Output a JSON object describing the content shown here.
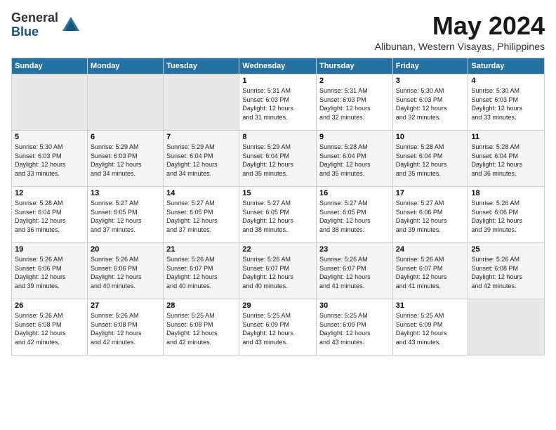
{
  "logo": {
    "general": "General",
    "blue": "Blue"
  },
  "title": "May 2024",
  "subtitle": "Alibunan, Western Visayas, Philippines",
  "days_header": [
    "Sunday",
    "Monday",
    "Tuesday",
    "Wednesday",
    "Thursday",
    "Friday",
    "Saturday"
  ],
  "weeks": [
    [
      {
        "day": "",
        "info": ""
      },
      {
        "day": "",
        "info": ""
      },
      {
        "day": "",
        "info": ""
      },
      {
        "day": "1",
        "info": "Sunrise: 5:31 AM\nSunset: 6:03 PM\nDaylight: 12 hours\nand 31 minutes."
      },
      {
        "day": "2",
        "info": "Sunrise: 5:31 AM\nSunset: 6:03 PM\nDaylight: 12 hours\nand 32 minutes."
      },
      {
        "day": "3",
        "info": "Sunrise: 5:30 AM\nSunset: 6:03 PM\nDaylight: 12 hours\nand 32 minutes."
      },
      {
        "day": "4",
        "info": "Sunrise: 5:30 AM\nSunset: 6:03 PM\nDaylight: 12 hours\nand 33 minutes."
      }
    ],
    [
      {
        "day": "5",
        "info": "Sunrise: 5:30 AM\nSunset: 6:03 PM\nDaylight: 12 hours\nand 33 minutes."
      },
      {
        "day": "6",
        "info": "Sunrise: 5:29 AM\nSunset: 6:03 PM\nDaylight: 12 hours\nand 34 minutes."
      },
      {
        "day": "7",
        "info": "Sunrise: 5:29 AM\nSunset: 6:04 PM\nDaylight: 12 hours\nand 34 minutes."
      },
      {
        "day": "8",
        "info": "Sunrise: 5:29 AM\nSunset: 6:04 PM\nDaylight: 12 hours\nand 35 minutes."
      },
      {
        "day": "9",
        "info": "Sunrise: 5:28 AM\nSunset: 6:04 PM\nDaylight: 12 hours\nand 35 minutes."
      },
      {
        "day": "10",
        "info": "Sunrise: 5:28 AM\nSunset: 6:04 PM\nDaylight: 12 hours\nand 35 minutes."
      },
      {
        "day": "11",
        "info": "Sunrise: 5:28 AM\nSunset: 6:04 PM\nDaylight: 12 hours\nand 36 minutes."
      }
    ],
    [
      {
        "day": "12",
        "info": "Sunrise: 5:28 AM\nSunset: 6:04 PM\nDaylight: 12 hours\nand 36 minutes."
      },
      {
        "day": "13",
        "info": "Sunrise: 5:27 AM\nSunset: 6:05 PM\nDaylight: 12 hours\nand 37 minutes."
      },
      {
        "day": "14",
        "info": "Sunrise: 5:27 AM\nSunset: 6:05 PM\nDaylight: 12 hours\nand 37 minutes."
      },
      {
        "day": "15",
        "info": "Sunrise: 5:27 AM\nSunset: 6:05 PM\nDaylight: 12 hours\nand 38 minutes."
      },
      {
        "day": "16",
        "info": "Sunrise: 5:27 AM\nSunset: 6:05 PM\nDaylight: 12 hours\nand 38 minutes."
      },
      {
        "day": "17",
        "info": "Sunrise: 5:27 AM\nSunset: 6:06 PM\nDaylight: 12 hours\nand 39 minutes."
      },
      {
        "day": "18",
        "info": "Sunrise: 5:26 AM\nSunset: 6:06 PM\nDaylight: 12 hours\nand 39 minutes."
      }
    ],
    [
      {
        "day": "19",
        "info": "Sunrise: 5:26 AM\nSunset: 6:06 PM\nDaylight: 12 hours\nand 39 minutes."
      },
      {
        "day": "20",
        "info": "Sunrise: 5:26 AM\nSunset: 6:06 PM\nDaylight: 12 hours\nand 40 minutes."
      },
      {
        "day": "21",
        "info": "Sunrise: 5:26 AM\nSunset: 6:07 PM\nDaylight: 12 hours\nand 40 minutes."
      },
      {
        "day": "22",
        "info": "Sunrise: 5:26 AM\nSunset: 6:07 PM\nDaylight: 12 hours\nand 40 minutes."
      },
      {
        "day": "23",
        "info": "Sunrise: 5:26 AM\nSunset: 6:07 PM\nDaylight: 12 hours\nand 41 minutes."
      },
      {
        "day": "24",
        "info": "Sunrise: 5:26 AM\nSunset: 6:07 PM\nDaylight: 12 hours\nand 41 minutes."
      },
      {
        "day": "25",
        "info": "Sunrise: 5:26 AM\nSunset: 6:08 PM\nDaylight: 12 hours\nand 42 minutes."
      }
    ],
    [
      {
        "day": "26",
        "info": "Sunrise: 5:26 AM\nSunset: 6:08 PM\nDaylight: 12 hours\nand 42 minutes."
      },
      {
        "day": "27",
        "info": "Sunrise: 5:26 AM\nSunset: 6:08 PM\nDaylight: 12 hours\nand 42 minutes."
      },
      {
        "day": "28",
        "info": "Sunrise: 5:25 AM\nSunset: 6:08 PM\nDaylight: 12 hours\nand 42 minutes."
      },
      {
        "day": "29",
        "info": "Sunrise: 5:25 AM\nSunset: 6:09 PM\nDaylight: 12 hours\nand 43 minutes."
      },
      {
        "day": "30",
        "info": "Sunrise: 5:25 AM\nSunset: 6:09 PM\nDaylight: 12 hours\nand 43 minutes."
      },
      {
        "day": "31",
        "info": "Sunrise: 5:25 AM\nSunset: 6:09 PM\nDaylight: 12 hours\nand 43 minutes."
      },
      {
        "day": "",
        "info": ""
      }
    ]
  ]
}
